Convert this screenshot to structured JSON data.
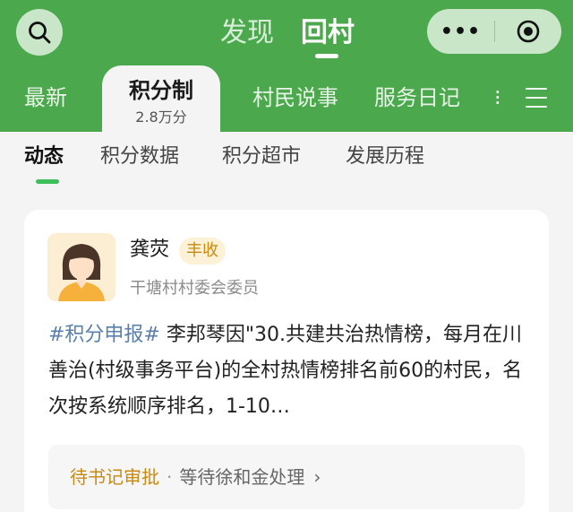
{
  "header": {
    "top_tabs": [
      "发现",
      "回村"
    ],
    "active_top_tab": "回村",
    "capsule": {
      "more_label": "•••"
    },
    "categories": {
      "latest": "最新",
      "active": {
        "label": "积分制",
        "count": "2.8万分"
      },
      "villager": "村民说事",
      "diary": "服务日记",
      "overflow": "⁝"
    }
  },
  "sub_tabs": {
    "items": [
      "动态",
      "积分数据",
      "积分超市",
      "发展历程"
    ],
    "active": "动态"
  },
  "post": {
    "author": "龚荧",
    "badge": "丰收",
    "role": "干塘村村委会委员",
    "tag": "#积分申报#",
    "text": " 李邦琴因\"30.共建共治热情榜，每月在川善治(村级事务平台)的全村热情榜排名前60的村民，名次按系统顺序排名，1-10…",
    "status": "待书记审批",
    "separator": "·",
    "handler": "等待徐和金处理",
    "arrow": "›"
  },
  "colors": {
    "brand_green": "#4ca84c",
    "accent_green": "#3fbf5a",
    "badge_orange": "#c98a12",
    "tag_blue": "#5a7fa8"
  },
  "icons": [
    "search-icon",
    "more-dots-icon",
    "close-target-icon",
    "menu-icon",
    "avatar",
    "chevron-right-icon"
  ]
}
